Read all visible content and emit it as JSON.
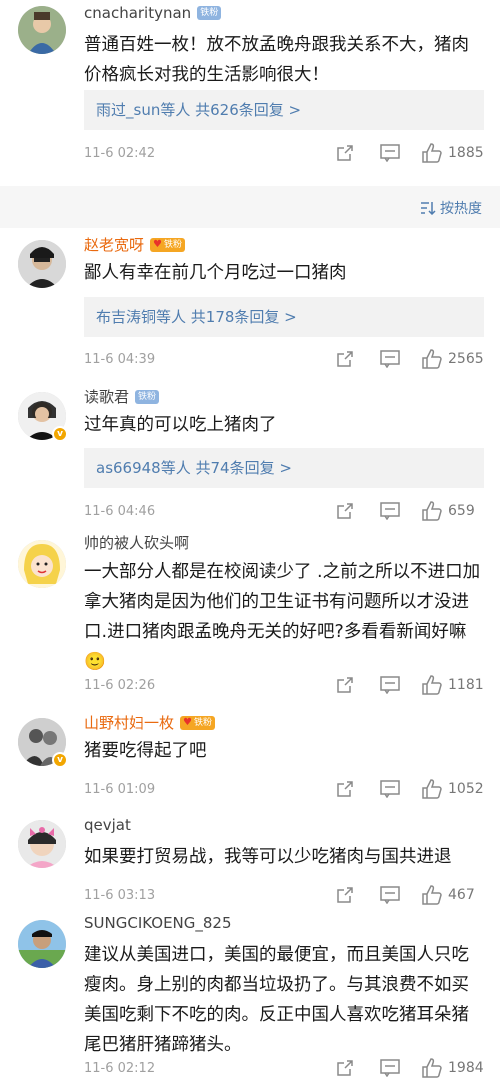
{
  "sort": {
    "label": "按热度"
  },
  "comments": [
    {
      "username": "cnacharitynan",
      "badge": "铁粉",
      "content": "普通百姓一枚！放不放孟晚舟跟我关系不大，猪肉价格疯长对我的生活影响很大！",
      "reply_user": "雨过_sun",
      "reply_text": "等人  共626条回复 >",
      "time": "11-6 02:42",
      "likes": "1885"
    },
    {
      "username": "赵老宽呀",
      "badge": "铁粉",
      "content": "鄙人有幸在前几个月吃过一口猪肉",
      "reply_user": "布吉涛铜",
      "reply_text": "等人  共178条回复 >",
      "time": "11-6 04:39",
      "likes": "2565"
    },
    {
      "username": "读歌君",
      "badge": "铁粉",
      "content": "过年真的可以吃上猪肉了",
      "reply_user": "as66948",
      "reply_text": "等人  共74条回复 >",
      "time": "11-6 04:46",
      "likes": "659"
    },
    {
      "username": "帅的被人砍头啊",
      "badge": "",
      "content": "一大部分人都是在校阅读少了 .之前之所以不进口加拿大猪肉是因为他们的卫生证书有问题所以才没进口.进口猪肉跟孟晚舟无关的好吧?多看看新闻好嘛 🙂",
      "time": "11-6 02:26",
      "likes": "1181"
    },
    {
      "username": "山野村妇一枚",
      "badge": "铁粉",
      "content": "猪要吃得起了吧",
      "time": "11-6 01:09",
      "likes": "1052"
    },
    {
      "username": "qevjat",
      "badge": "",
      "content": "如果要打贸易战，我等可以少吃猪肉与国共进退",
      "time": "11-6 03:13",
      "likes": "467"
    },
    {
      "username": "SUNGCIKOENG_825",
      "badge": "",
      "content": "建议从美国进口，美国的最便宜，而且美国人只吃瘦肉。身上别的肉都当垃圾扔了。与其浪费不如买美国吃剩下不吃的肉。反正中国人喜欢吃猪耳朵猪尾巴猪肝猪蹄猪头。",
      "time": "11-6 02:12",
      "likes": "1984"
    }
  ]
}
